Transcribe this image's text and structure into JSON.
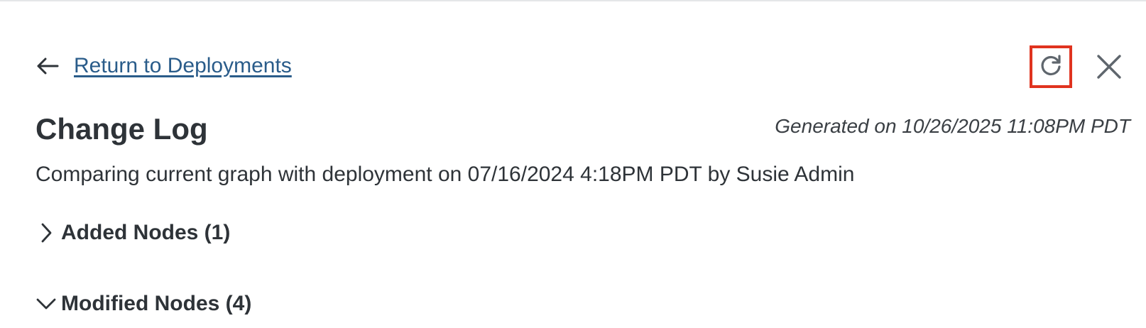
{
  "header": {
    "back_link": "Return to Deployments",
    "back_icon": "arrow-left-icon",
    "refresh_icon": "refresh-icon",
    "close_icon": "close-icon",
    "highlight_color": "#e0331f",
    "link_color": "#2a5c8a"
  },
  "page": {
    "title": "Change Log",
    "generated": "Generated on 10/26/2025 11:08PM PDT",
    "subtitle": "Comparing current graph with deployment on 07/16/2024 4:18PM PDT by Susie Admin"
  },
  "sections": [
    {
      "label": "Added Nodes (1)",
      "expanded": false,
      "icon": "chevron-right-icon"
    },
    {
      "label": "Modified Nodes (4)",
      "expanded": true,
      "icon": "chevron-down-icon"
    }
  ]
}
